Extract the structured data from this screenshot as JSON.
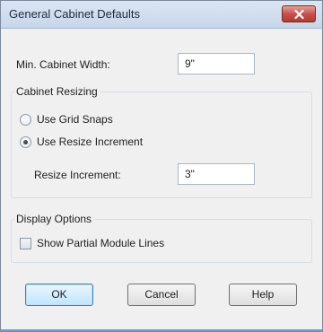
{
  "dialog": {
    "title": "General Cabinet Defaults",
    "close_icon": "close-x-icon"
  },
  "min_cabinet_width": {
    "label": "Min. Cabinet Width:",
    "value": "9\""
  },
  "cabinet_resizing": {
    "group_label": "Cabinet Resizing",
    "use_grid_snaps": {
      "label": "Use Grid Snaps",
      "selected": false
    },
    "use_resize_increment": {
      "label": "Use Resize Increment",
      "selected": true
    },
    "resize_increment": {
      "label": "Resize Increment:",
      "value": "3\""
    }
  },
  "display_options": {
    "group_label": "Display Options",
    "show_partial_module_lines": {
      "label": "Show Partial Module Lines",
      "checked": false
    }
  },
  "buttons": {
    "ok": "OK",
    "cancel": "Cancel",
    "help": "Help"
  },
  "colors": {
    "close_button": "#c75050",
    "default_button_border": "#3c7fb1"
  }
}
